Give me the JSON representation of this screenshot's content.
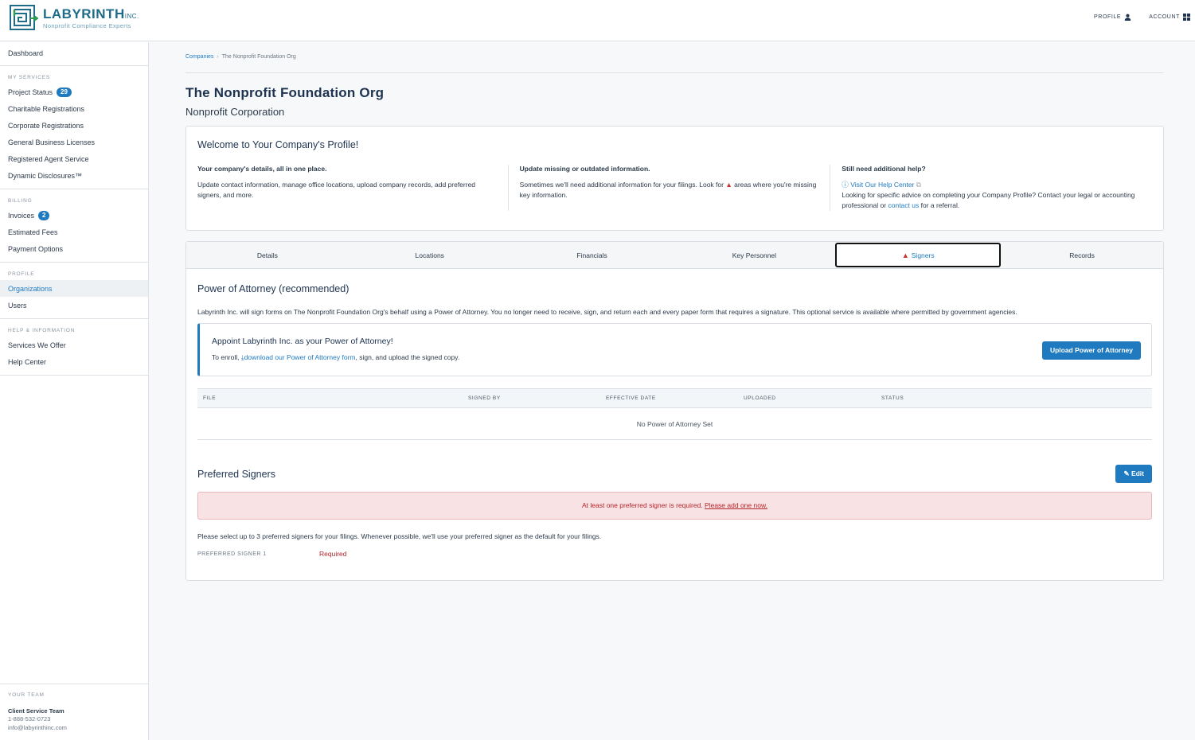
{
  "brand": {
    "name": "LABYRINTH",
    "inc": "INC.",
    "tagline": "Nonprofit Compliance Experts"
  },
  "topnav": {
    "profile": "PROFILE",
    "account": "ACCOUNT"
  },
  "sidebar": {
    "dashboard": "Dashboard",
    "my_services": {
      "heading": "MY SERVICES",
      "items": [
        {
          "label": "Project Status",
          "badge": "29"
        },
        {
          "label": "Charitable Registrations"
        },
        {
          "label": "Corporate Registrations"
        },
        {
          "label": "General Business Licenses"
        },
        {
          "label": "Registered Agent Service"
        },
        {
          "label": "Dynamic Disclosures™"
        }
      ]
    },
    "billing": {
      "heading": "BILLING",
      "items": [
        {
          "label": "Invoices",
          "badge": "2"
        },
        {
          "label": "Estimated Fees"
        },
        {
          "label": "Payment Options"
        }
      ]
    },
    "profile": {
      "heading": "PROFILE",
      "items": [
        {
          "label": "Organizations"
        },
        {
          "label": "Users"
        }
      ]
    },
    "help": {
      "heading": "HELP & INFORMATION",
      "items": [
        {
          "label": "Services We Offer"
        },
        {
          "label": "Help Center"
        }
      ]
    },
    "team": {
      "heading": "YOUR TEAM",
      "name": "Client Service Team",
      "phone": "1-888-532-0723",
      "email": "info@labyrinthinc.com"
    }
  },
  "breadcrumb": {
    "root": "Companies",
    "current": "The Nonprofit Foundation Org"
  },
  "page": {
    "title": "The Nonprofit Foundation Org",
    "subtitle": "Nonprofit Corporation"
  },
  "welcome": {
    "title": "Welcome to Your Company's Profile!",
    "col1": {
      "heading": "Your company's details, all in one place.",
      "text": "Update contact information, manage office locations, upload company records, add preferred signers, and more."
    },
    "col2": {
      "heading": "Update missing or outdated information.",
      "text_before": "Sometimes we'll need additional information for your filings. Look for",
      "text_after": "areas where you're missing key information."
    },
    "col3": {
      "heading": "Still need additional help?",
      "help_link": "Visit Our Help Center",
      "text_before": "Looking for specific advice on completing your Company Profile? Contact your legal or accounting professional or",
      "contact_link": "contact us",
      "text_after": "for a referral."
    }
  },
  "tabs": [
    "Details",
    "Locations",
    "Financials",
    "Key Personnel",
    "Signers",
    "Records"
  ],
  "active_tab": "Signers",
  "poa": {
    "title": "Power of Attorney (recommended)",
    "description": "Labyrinth Inc. will sign forms on The Nonprofit Foundation Org's behalf using a Power of Attorney. You no longer need to receive, sign, and return each and every paper form that requires a signature. This optional service is available where permitted by government agencies.",
    "appoint_title": "Appoint Labyrinth Inc. as your Power of Attorney!",
    "appoint_before": "To enroll,",
    "appoint_link": "download our Power of Attorney form",
    "appoint_after": ", sign, and upload the signed copy.",
    "upload_button": "Upload Power of Attorney",
    "table": {
      "columns": [
        "FILE",
        "SIGNED BY",
        "EFFECTIVE DATE",
        "UPLOADED",
        "STATUS"
      ],
      "empty": "No Power of Attorney Set"
    }
  },
  "preferred": {
    "title": "Preferred Signers",
    "edit_button": "Edit",
    "alert_text": "At least one preferred signer is required.",
    "alert_link": "Please add one now.",
    "description": "Please select up to 3 preferred signers for your filings. Whenever possible, we'll use your preferred signer as the default for your filings.",
    "signer_label": "PREFERRED SIGNER 1",
    "signer_value": "Required"
  },
  "colors": {
    "accent": "#1f7ac0",
    "error": "#c9302c",
    "alert_bg": "#f9e2e4"
  }
}
